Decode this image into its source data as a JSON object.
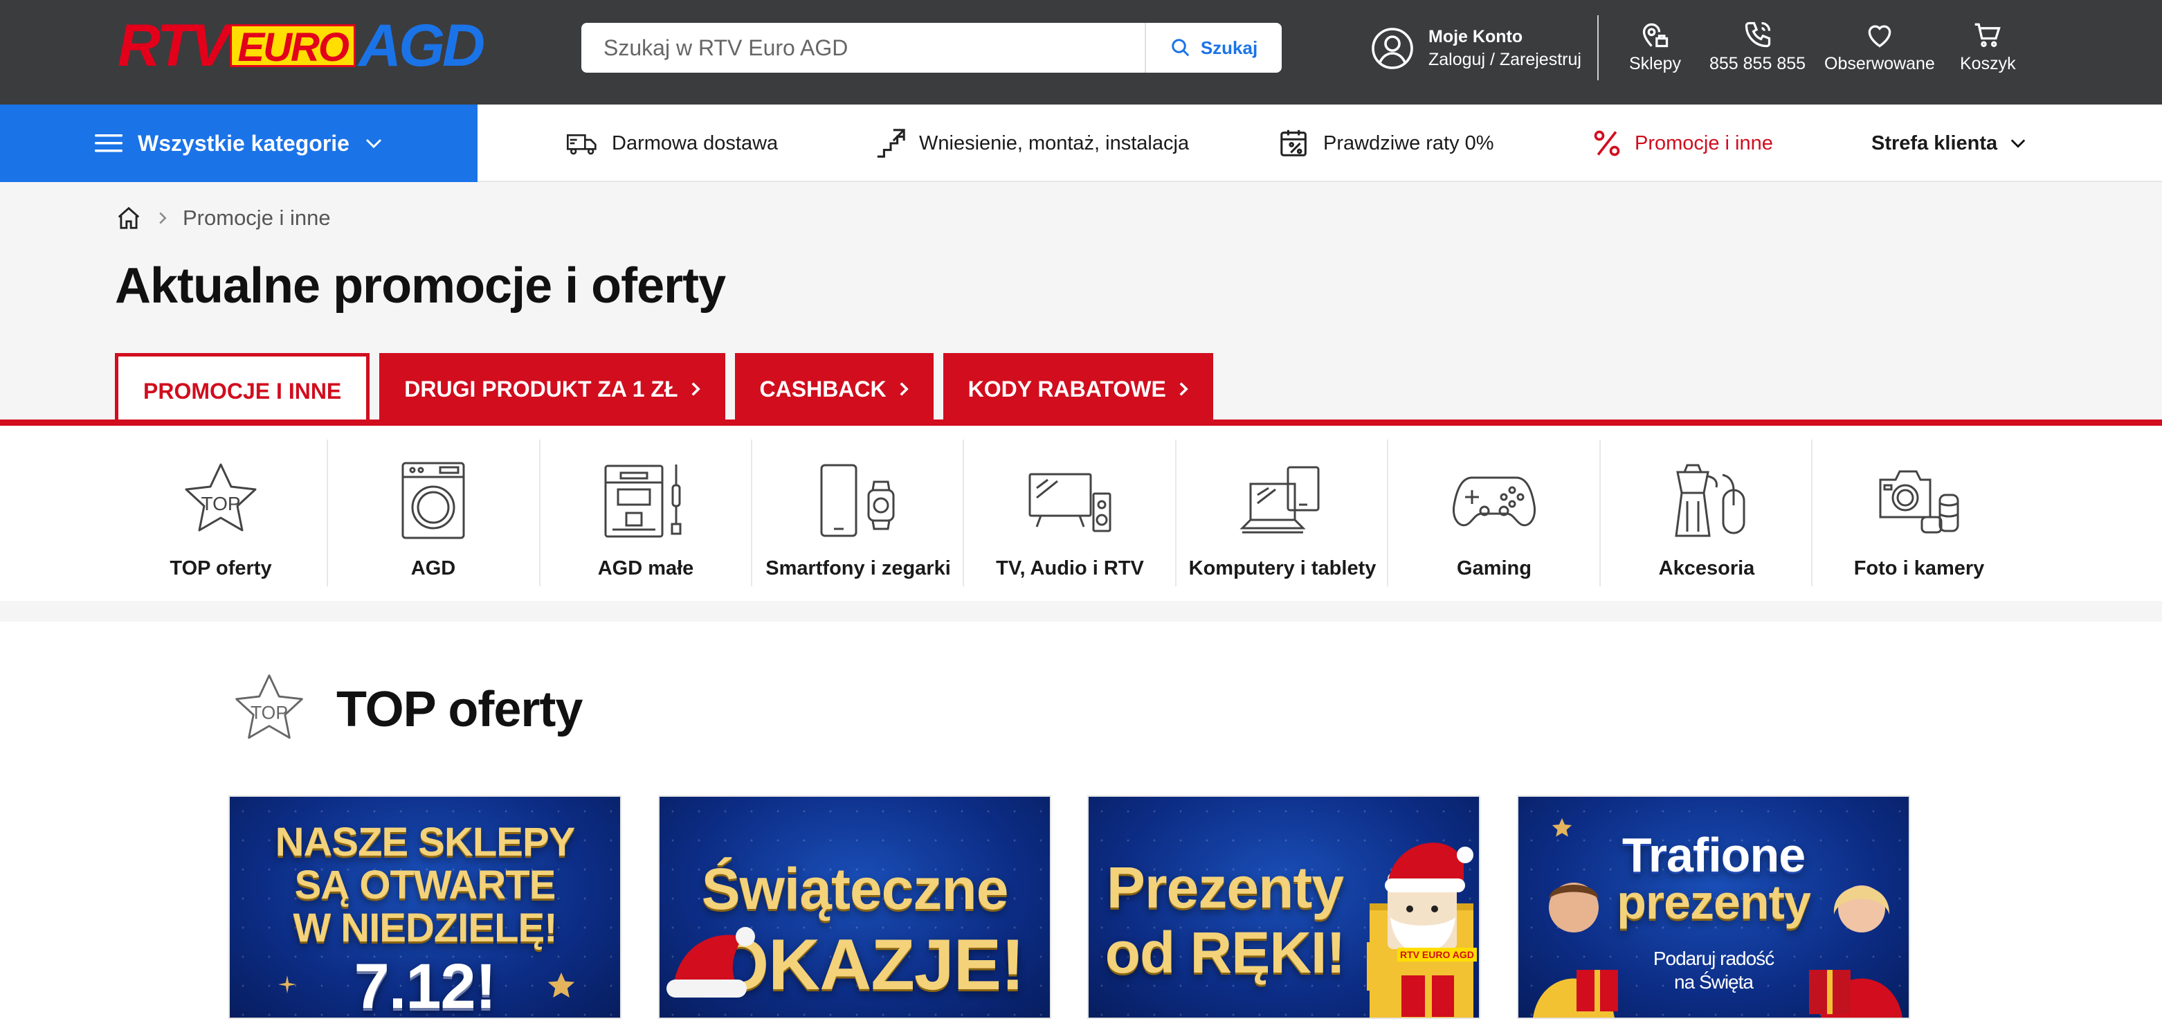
{
  "header": {
    "logo": {
      "part1": "RTV",
      "part2": "EURO",
      "part3": "AGD"
    },
    "search": {
      "placeholder": "Szukaj w RTV Euro AGD",
      "button_label": "Szukaj"
    },
    "account": {
      "title": "Moje Konto",
      "subtitle": "Zaloguj / Zarejestruj"
    },
    "shops_label": "Sklepy",
    "phone_label": "855 855 855",
    "wishlist_label": "Obserwowane",
    "cart_label": "Koszyk"
  },
  "nav": {
    "all_categories": "Wszystkie kategorie",
    "items": [
      "Darmowa dostawa",
      "Wniesienie, montaż, instalacja",
      "Prawdziwe raty 0%",
      "Promocje i inne",
      "Strefa klienta"
    ]
  },
  "breadcrumb": {
    "current": "Promocje i inne"
  },
  "page": {
    "title": "Aktualne promocje i oferty"
  },
  "tabs": [
    "PROMOCJE I INNE",
    "DRUGI PRODUKT ZA 1 ZŁ",
    "CASHBACK",
    "KODY RABATOWE"
  ],
  "categories": [
    {
      "label": "TOP oferty",
      "icon": "top-star-icon",
      "badge": "TOP"
    },
    {
      "label": "AGD",
      "icon": "washing-machine-icon"
    },
    {
      "label": "AGD małe",
      "icon": "coffee-machine-icon"
    },
    {
      "label": "Smartfony i zegarki",
      "icon": "smartphone-watch-icon"
    },
    {
      "label": "TV, Audio i RTV",
      "icon": "tv-speaker-icon"
    },
    {
      "label": "Komputery i tablety",
      "icon": "laptop-tablet-icon"
    },
    {
      "label": "Gaming",
      "icon": "gamepad-icon"
    },
    {
      "label": "Akcesoria",
      "icon": "moka-mouse-icon"
    },
    {
      "label": "Foto i kamery",
      "icon": "camera-icon"
    }
  ],
  "top_section": {
    "title": "TOP oferty",
    "badge": "TOP"
  },
  "promos": [
    {
      "lines": [
        "NASZE SKLEPY",
        "SĄ OTWARTE",
        "W NIEDZIELĘ!",
        "7.12!"
      ]
    },
    {
      "lines": [
        "Świąteczne",
        "OKAZJE!"
      ]
    },
    {
      "lines": [
        "Prezenty",
        "od RĘKI!"
      ],
      "box_label": "RTV EURO AGD"
    },
    {
      "lines": [
        "Trafione",
        "prezenty"
      ],
      "sub": [
        "Podaruj radość",
        "na Święta"
      ]
    }
  ],
  "colors": {
    "brand_red": "#d10d1e",
    "brand_blue": "#1b73e8",
    "header_bg": "#3b3c3e",
    "promo_gold": "#f3d27a"
  }
}
